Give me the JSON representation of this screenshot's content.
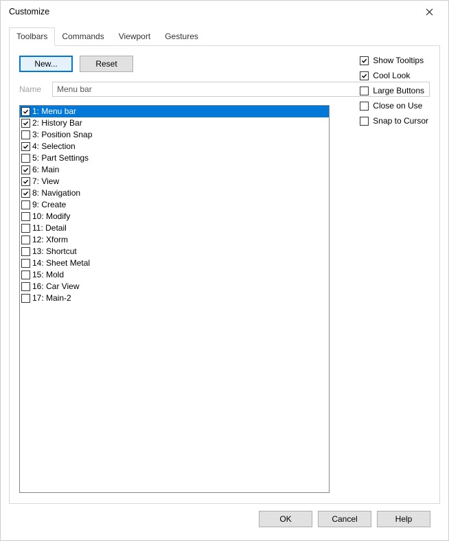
{
  "window": {
    "title": "Customize"
  },
  "tabs": [
    {
      "label": "Toolbars",
      "active": true
    },
    {
      "label": "Commands",
      "active": false
    },
    {
      "label": "Viewport",
      "active": false
    },
    {
      "label": "Gestures",
      "active": false
    }
  ],
  "buttons": {
    "new": "New...",
    "reset": "Reset",
    "ok": "OK",
    "cancel": "Cancel",
    "help": "Help"
  },
  "name_field": {
    "label": "Name",
    "value": "Menu bar"
  },
  "toolbars_list": [
    {
      "num": 1,
      "label": "Menu bar",
      "checked": true,
      "selected": true
    },
    {
      "num": 2,
      "label": "History Bar",
      "checked": true,
      "selected": false
    },
    {
      "num": 3,
      "label": "Position Snap",
      "checked": false,
      "selected": false
    },
    {
      "num": 4,
      "label": "Selection",
      "checked": true,
      "selected": false
    },
    {
      "num": 5,
      "label": "Part Settings",
      "checked": false,
      "selected": false
    },
    {
      "num": 6,
      "label": "Main",
      "checked": true,
      "selected": false
    },
    {
      "num": 7,
      "label": "View",
      "checked": true,
      "selected": false
    },
    {
      "num": 8,
      "label": "Navigation",
      "checked": true,
      "selected": false
    },
    {
      "num": 9,
      "label": "Create",
      "checked": false,
      "selected": false
    },
    {
      "num": 10,
      "label": "Modify",
      "checked": false,
      "selected": false
    },
    {
      "num": 11,
      "label": "Detail",
      "checked": false,
      "selected": false
    },
    {
      "num": 12,
      "label": "Xform",
      "checked": false,
      "selected": false
    },
    {
      "num": 13,
      "label": "Shortcut",
      "checked": false,
      "selected": false
    },
    {
      "num": 14,
      "label": "Sheet Metal",
      "checked": false,
      "selected": false
    },
    {
      "num": 15,
      "label": "Mold",
      "checked": false,
      "selected": false
    },
    {
      "num": 16,
      "label": "Car View",
      "checked": false,
      "selected": false
    },
    {
      "num": 17,
      "label": "Main-2",
      "checked": false,
      "selected": false
    }
  ],
  "options": [
    {
      "label": "Show Tooltips",
      "checked": true
    },
    {
      "label": "Cool Look",
      "checked": true
    },
    {
      "label": "Large Buttons",
      "checked": false
    },
    {
      "label": "Close on Use",
      "checked": false
    },
    {
      "label": "Snap to Cursor",
      "checked": false
    }
  ]
}
